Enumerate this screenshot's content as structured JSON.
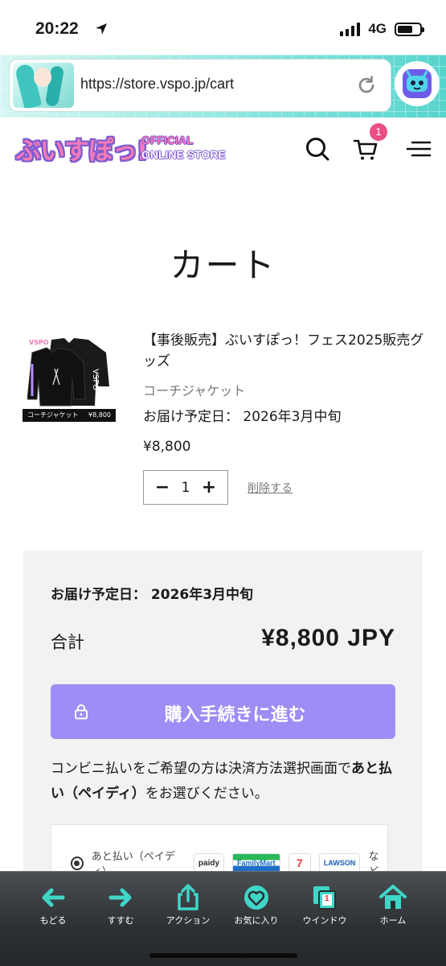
{
  "status_bar": {
    "time": "20:22",
    "network": "4G"
  },
  "browser": {
    "url": "https://store.vspo.jp/cart"
  },
  "header": {
    "logo_main": "ぶいすぽっ!",
    "logo_sub_line1": "OFFICIAL",
    "logo_sub_line2": "ONLINE STORE",
    "cart_count": "1"
  },
  "page": {
    "title": "カート"
  },
  "item": {
    "thumb_label": "コーチジャケット",
    "thumb_price": "¥8,800",
    "title": "【事後販売】ぶいすぽっ！フェス2025販売グッズ",
    "variant": "コーチジャケット",
    "delivery": "お届け予定日： 2026年3月中旬",
    "price": "¥8,800",
    "quantity": "1",
    "qty_minus": "−",
    "qty_plus": "+",
    "remove": "削除する"
  },
  "summary": {
    "delivery": "お届け予定日： 2026年3月中旬",
    "total_label": "合計",
    "total_value": "¥8,800 JPY",
    "checkout_label": "購入手続きに進む",
    "konbini_part1": "コンビニ払いをご希望の方は決済方法選択画面で",
    "konbini_bold": "あと払い（ペイディ）",
    "konbini_part2": "をお選びください。",
    "pay_option": "あと払い（ペイディ）",
    "pay_paidy": "paidy",
    "pay_familymart": "FamilyMart",
    "pay_seven": "7",
    "pay_lawson": "LAWSON",
    "pay_etc": "など"
  },
  "toolbar": {
    "back": "もどる",
    "forward": "すすむ",
    "action": "アクション",
    "favorites": "お気に入り",
    "windows": "ウインドウ",
    "windows_count": "1",
    "home": "ホーム"
  },
  "colors": {
    "accent": "#9f8cf5",
    "badge": "#e94f83",
    "logo_pink": "#f27ab8",
    "logo_purple": "#7f5ad1",
    "toolbar_icon": "#3fd6c8"
  }
}
